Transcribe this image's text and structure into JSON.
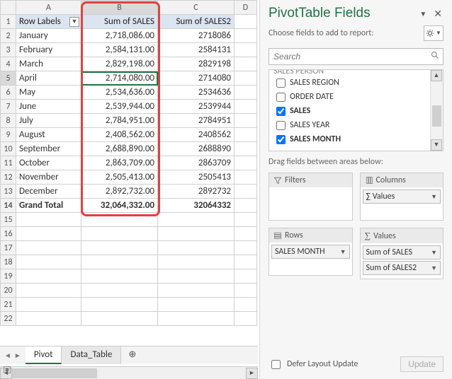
{
  "columns": [
    "A",
    "B",
    "C",
    "D"
  ],
  "pivotHeaders": {
    "rowLabels": "Row Labels",
    "sumSales": "Sum of SALES",
    "sumSales2": "Sum of SALES2"
  },
  "rows": [
    {
      "r": 2,
      "label": "January",
      "b": "2,718,086.00",
      "c": "2718086"
    },
    {
      "r": 3,
      "label": "February",
      "b": "2,584,131.00",
      "c": "2584131"
    },
    {
      "r": 4,
      "label": "March",
      "b": "2,829,198.00",
      "c": "2829198"
    },
    {
      "r": 5,
      "label": "April",
      "b": "2,714,080.00",
      "c": "2714080"
    },
    {
      "r": 6,
      "label": "May",
      "b": "2,534,636.00",
      "c": "2534636"
    },
    {
      "r": 7,
      "label": "June",
      "b": "2,539,944.00",
      "c": "2539944"
    },
    {
      "r": 8,
      "label": "July",
      "b": "2,784,951.00",
      "c": "2784951"
    },
    {
      "r": 9,
      "label": "August",
      "b": "2,408,562.00",
      "c": "2408562"
    },
    {
      "r": 10,
      "label": "September",
      "b": "2,688,890.00",
      "c": "2688890"
    },
    {
      "r": 11,
      "label": "October",
      "b": "2,863,709.00",
      "c": "2863709"
    },
    {
      "r": 12,
      "label": "November",
      "b": "2,505,413.00",
      "c": "2505413"
    },
    {
      "r": 13,
      "label": "December",
      "b": "2,892,732.00",
      "c": "2892732"
    }
  ],
  "totalsRow": {
    "r": 14,
    "label": "Grand Total",
    "b": "32,064,332.00",
    "c": "32064332"
  },
  "emptyRows": [
    15,
    16,
    17,
    18,
    19,
    20,
    21,
    22
  ],
  "selectedCell": {
    "row": 5,
    "col": "B"
  },
  "tabs": {
    "active": "Pivot",
    "other": "Data_Table"
  },
  "pane": {
    "title": "PivotTable Fields",
    "chooseText": "Choose fields to add to report:",
    "searchPlaceholder": "Search",
    "fields": [
      {
        "label": "SALES PERSON",
        "checked": false,
        "cut": true
      },
      {
        "label": "SALES REGION",
        "checked": false
      },
      {
        "label": "ORDER DATE",
        "checked": false
      },
      {
        "label": "SALES",
        "checked": true,
        "bold": true
      },
      {
        "label": "SALES YEAR",
        "checked": false
      },
      {
        "label": "SALES MONTH",
        "checked": true,
        "bold": true
      }
    ],
    "dragLabel": "Drag fields between areas below:",
    "areas": {
      "filters": "Filters",
      "columns": "Columns",
      "rowsLabel": "Rows",
      "values": "Values",
      "columnsChip": "∑  Values",
      "rowsChip": "SALES MONTH",
      "valChip1": "Sum of SALES",
      "valChip2": "Sum of SALES2"
    },
    "deferLabel": "Defer Layout Update",
    "updateBtn": "Update"
  }
}
